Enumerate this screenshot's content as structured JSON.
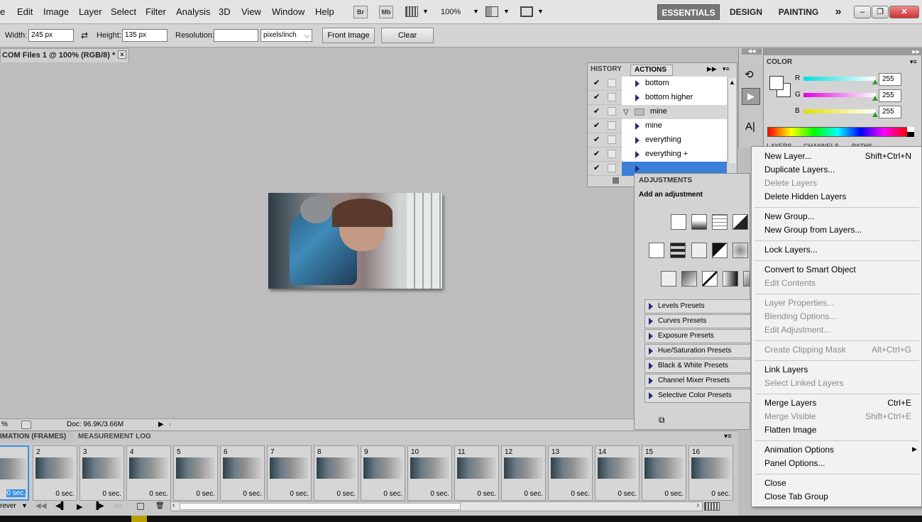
{
  "menubar": {
    "items": [
      "e",
      "Edit",
      "Image",
      "Layer",
      "Select",
      "Filter",
      "Analysis",
      "3D",
      "View",
      "Window",
      "Help"
    ],
    "br": "Br",
    "mb": "Mb",
    "zoom": "100%",
    "workspaces": [
      "ESSENTIALS",
      "DESIGN",
      "PAINTING"
    ],
    "more": "»"
  },
  "options": {
    "width_label": "Width:",
    "width_value": "245 px",
    "height_label": "Height:",
    "height_value": "135 px",
    "resolution_label": "Resolution:",
    "resolution_value": "",
    "units": "pixels/inch",
    "front_image": "Front Image",
    "clear": "Clear"
  },
  "document": {
    "tab_title": "COM Files 1 @ 100% (RGB/8) *",
    "zoom": "%",
    "doc_info": "Doc: 96.9K/3.66M"
  },
  "history_panel": {
    "tabs": [
      "HISTORY",
      "ACTIONS"
    ],
    "rows": [
      {
        "label": "bottom",
        "check": "✔"
      },
      {
        "label": "bottom higher",
        "check": "✔"
      },
      {
        "label": "mine",
        "check": "✔",
        "folder": true
      },
      {
        "label": "mine",
        "check": "✔"
      },
      {
        "label": "everything",
        "check": "✔"
      },
      {
        "label": "everything +",
        "check": "✔"
      },
      {
        "label": "",
        "check": "✔"
      }
    ]
  },
  "adjustments": {
    "title": "ADJUSTMENTS",
    "subtitle": "Add an adjustment",
    "presets": [
      "Levels Presets",
      "Curves Presets",
      "Exposure Presets",
      "Hue/Saturation Presets",
      "Black & White Presets",
      "Channel Mixer Presets",
      "Selective Color Presets"
    ]
  },
  "color_panel": {
    "title": "COLOR",
    "channels": [
      {
        "label": "R",
        "value": "255",
        "color": "#00e0e0"
      },
      {
        "label": "G",
        "value": "255",
        "color": "#e000e0"
      },
      {
        "label": "B",
        "value": "255",
        "color": "#e0e000"
      }
    ]
  },
  "layers_tabs": [
    "LAYERS",
    "CHANNELS",
    "PATHS"
  ],
  "animation": {
    "tabs": [
      "IMATION (FRAMES)",
      "MEASUREMENT LOG"
    ],
    "loop": "rever",
    "frames": [
      {
        "n": "",
        "d": "0 sec."
      },
      {
        "n": "2",
        "d": "0 sec."
      },
      {
        "n": "3",
        "d": "0 sec."
      },
      {
        "n": "4",
        "d": "0 sec."
      },
      {
        "n": "5",
        "d": "0 sec."
      },
      {
        "n": "6",
        "d": "0 sec."
      },
      {
        "n": "7",
        "d": "0 sec."
      },
      {
        "n": "8",
        "d": "0 sec."
      },
      {
        "n": "9",
        "d": "0 sec."
      },
      {
        "n": "10",
        "d": "0 sec."
      },
      {
        "n": "11",
        "d": "0 sec."
      },
      {
        "n": "12",
        "d": "0 sec."
      },
      {
        "n": "13",
        "d": "0 sec."
      },
      {
        "n": "14",
        "d": "0 sec."
      },
      {
        "n": "15",
        "d": "0 sec."
      },
      {
        "n": "16",
        "d": "0 sec."
      }
    ]
  },
  "context_menu": {
    "items": [
      {
        "label": "New Layer...",
        "shortcut": "Shift+Ctrl+N",
        "disabled": false
      },
      {
        "label": "Duplicate Layers...",
        "shortcut": "",
        "disabled": false
      },
      {
        "label": "Delete Layers",
        "shortcut": "",
        "disabled": true
      },
      {
        "label": "Delete Hidden Layers",
        "shortcut": "",
        "disabled": false
      },
      {
        "sep": true
      },
      {
        "label": "New Group...",
        "shortcut": "",
        "disabled": false
      },
      {
        "label": "New Group from Layers...",
        "shortcut": "",
        "disabled": false
      },
      {
        "sep": true
      },
      {
        "label": "Lock Layers...",
        "shortcut": "",
        "disabled": false
      },
      {
        "sep": true
      },
      {
        "label": "Convert to Smart Object",
        "shortcut": "",
        "disabled": false
      },
      {
        "label": "Edit Contents",
        "shortcut": "",
        "disabled": true
      },
      {
        "sep": true
      },
      {
        "label": "Layer Properties...",
        "shortcut": "",
        "disabled": true
      },
      {
        "label": "Blending Options...",
        "shortcut": "",
        "disabled": true
      },
      {
        "label": "Edit Adjustment...",
        "shortcut": "",
        "disabled": true
      },
      {
        "sep": true
      },
      {
        "label": "Create Clipping Mask",
        "shortcut": "Alt+Ctrl+G",
        "disabled": true
      },
      {
        "sep": true
      },
      {
        "label": "Link Layers",
        "shortcut": "",
        "disabled": false
      },
      {
        "label": "Select Linked Layers",
        "shortcut": "",
        "disabled": true
      },
      {
        "sep": true
      },
      {
        "label": "Merge Layers",
        "shortcut": "Ctrl+E",
        "disabled": false
      },
      {
        "label": "Merge Visible",
        "shortcut": "Shift+Ctrl+E",
        "disabled": true
      },
      {
        "label": "Flatten Image",
        "shortcut": "",
        "disabled": false
      },
      {
        "sep": true
      },
      {
        "label": "Animation Options",
        "shortcut": "",
        "disabled": false,
        "submenu": true
      },
      {
        "label": "Panel Options...",
        "shortcut": "",
        "disabled": false
      },
      {
        "sep": true
      },
      {
        "label": "Close",
        "shortcut": "",
        "disabled": false
      },
      {
        "label": "Close Tab Group",
        "shortcut": "",
        "disabled": false
      }
    ]
  }
}
